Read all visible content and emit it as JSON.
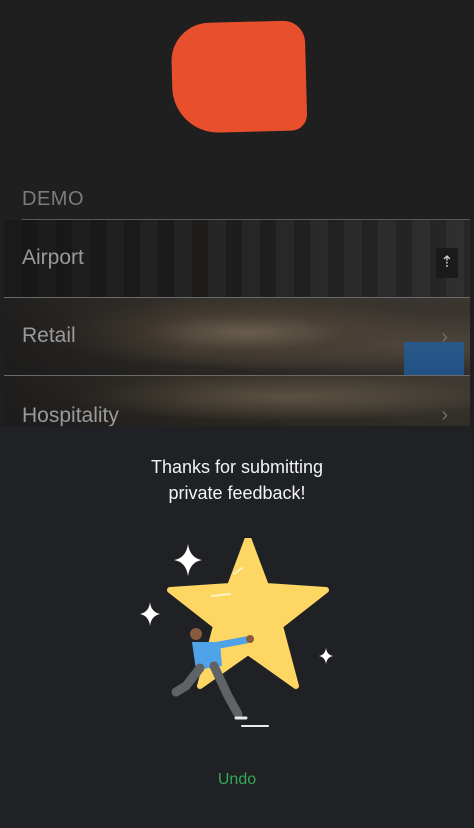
{
  "background_app": {
    "section_label": "DEMO",
    "demos": [
      {
        "label": "Airport",
        "chevron": "›"
      },
      {
        "label": "Retail",
        "chevron": "›"
      },
      {
        "label": "Hospitality",
        "chevron": "›"
      }
    ],
    "redaction_color": "#e8502d"
  },
  "feedback_sheet": {
    "title_line1": "Thanks for submitting",
    "title_line2": "private feedback!",
    "illustration": "person-carrying-star",
    "undo_label": "Undo",
    "accent_color": "#34a853",
    "star_color": "#fdd663",
    "background_color": "#202124"
  }
}
